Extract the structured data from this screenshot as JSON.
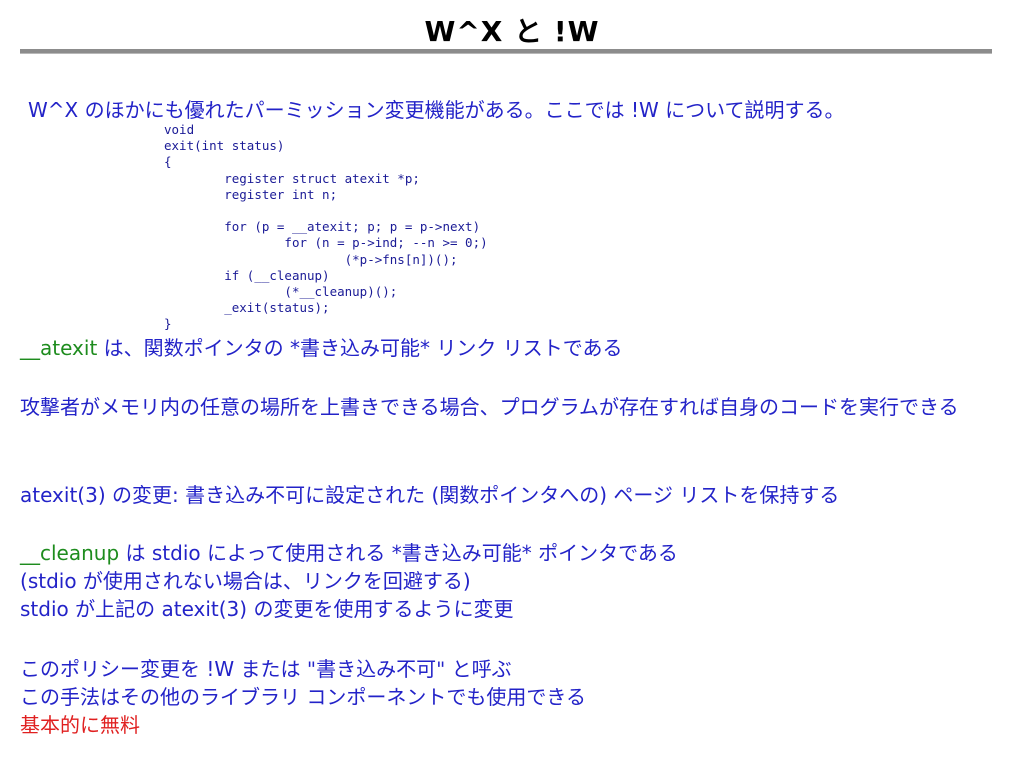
{
  "slide": {
    "title": "W^X と !W"
  },
  "intro": {
    "term_wx": "W^X",
    "text_a": " のほかにも優れたパーミッション変更機能がある。ここでは ",
    "term_w": "!W",
    "text_b": " について説明する。"
  },
  "code": "void\nexit(int status)\n{\n\tregister struct atexit *p;\n\tregister int n;\n\n\tfor (p = __atexit; p; p = p->next)\n\t\tfor (n = p->ind; --n >= 0;)\n\t\t\t(*p->fns[n])();\n\tif (__cleanup)\n\t\t(*__cleanup)();\n\t_exit(status);\n}",
  "paragraphs": {
    "atexit_note": {
      "term": "__atexit",
      "text_a": " は、関数ポインタの ",
      "emph": "*書き込み可能*",
      "text_b": " リンク リストである"
    },
    "attacker_note": {
      "text": "攻撃者がメモリ内の任意の場所を上書きできる場合、プログラムが存在すれば自身のコードを実行できる"
    },
    "atexit_change": {
      "term": "atexit(3)",
      "text_a": " の変更",
      "colon": ":",
      "text_b": " 書き込み不可に設定された ",
      "paren_open": "(",
      "text_c": "関数ポインタへの",
      "paren_close": ")",
      "text_d": " ページ リストを保持する"
    },
    "cleanup_note": {
      "line1": {
        "term": "__cleanup",
        "text_a": " は ",
        "stdio": "stdio",
        "text_b": " によって使用される ",
        "emph": "*書き込み可能*",
        "text_c": " ポインタである"
      },
      "line2": {
        "paren_open": "(",
        "stdio": "stdio",
        "text_a": " が使用されない場合は、リンクを回避する",
        "paren_close": ")"
      },
      "line3": {
        "stdio": "stdio",
        "text_a": " が上記の ",
        "term": "atexit(3)",
        "text_b": " の変更を使用するように変更"
      }
    },
    "policy_note": {
      "line1": {
        "text_a": "このポリシー変更を ",
        "term": "!W",
        "text_b": " または ",
        "quoted": "\"書き込み不可\"",
        "text_c": " と呼ぶ"
      },
      "line2": {
        "text": "この手法はその他のライブラリ コンポーネントでも使用できる"
      },
      "line3": {
        "text": "基本的に無料"
      }
    }
  },
  "colors": {
    "body_text": "#2323c8",
    "term_green": "#1e8c1e",
    "highlight_red": "#e02020",
    "code_text": "#1a1a96",
    "title_rule": "#8c8c8c"
  }
}
